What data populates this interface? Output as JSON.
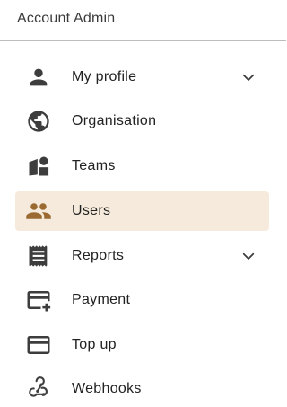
{
  "header": {
    "title": "Account Admin"
  },
  "colors": {
    "icon": "#3d3d3d",
    "active_icon": "#9a6a32",
    "active_bg": "#f5eadb",
    "divider": "#bdbdbd"
  },
  "nav": {
    "items": [
      {
        "label": "My profile",
        "icon": "person-icon",
        "expandable": true,
        "active": false
      },
      {
        "label": "Organisation",
        "icon": "globe-icon",
        "expandable": false,
        "active": false
      },
      {
        "label": "Teams",
        "icon": "teams-icon",
        "expandable": false,
        "active": false
      },
      {
        "label": "Users",
        "icon": "group-icon",
        "expandable": false,
        "active": true
      },
      {
        "label": "Reports",
        "icon": "receipt-icon",
        "expandable": true,
        "active": false
      },
      {
        "label": "Payment",
        "icon": "add-card-icon",
        "expandable": false,
        "active": false
      },
      {
        "label": "Top up",
        "icon": "credit-card-icon",
        "expandable": false,
        "active": false
      },
      {
        "label": "Webhooks",
        "icon": "webhook-icon",
        "expandable": false,
        "active": false
      }
    ]
  }
}
